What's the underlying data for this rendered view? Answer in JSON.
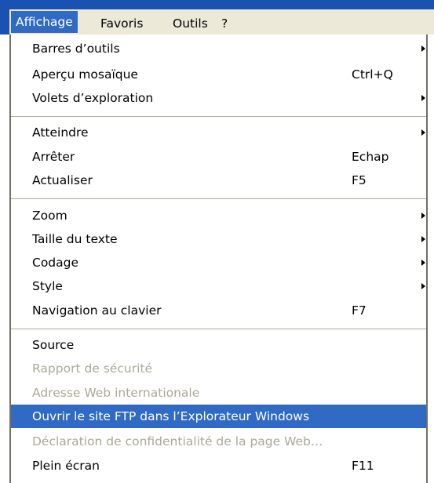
{
  "colors": {
    "frame": "#1a52b3",
    "menu_background": "#ece9d8",
    "highlight": "#316ac5",
    "disabled_text": "#aca899",
    "text": "#000000"
  },
  "menubar": {
    "items": [
      {
        "label": "Affichage",
        "active": true
      },
      {
        "label": "Favoris",
        "active": false
      },
      {
        "label": "Outils",
        "active": false
      },
      {
        "label": "?",
        "active": false
      }
    ]
  },
  "menu": {
    "items": [
      {
        "label": "Barres d’outils",
        "shortcut": "",
        "submenu": true,
        "enabled": true,
        "highlighted": false
      },
      {
        "label": "Aperçu mosaïque",
        "shortcut": "Ctrl+Q",
        "submenu": false,
        "enabled": true,
        "highlighted": false
      },
      {
        "label": "Volets d’exploration",
        "shortcut": "",
        "submenu": true,
        "enabled": true,
        "highlighted": false
      },
      {
        "label": "Atteindre",
        "shortcut": "",
        "submenu": true,
        "enabled": true,
        "highlighted": false
      },
      {
        "label": "Arrêter",
        "shortcut": "Echap",
        "submenu": false,
        "enabled": true,
        "highlighted": false
      },
      {
        "label": "Actualiser",
        "shortcut": "F5",
        "submenu": false,
        "enabled": true,
        "highlighted": false
      },
      {
        "label": "Zoom",
        "shortcut": "",
        "submenu": true,
        "enabled": true,
        "highlighted": false
      },
      {
        "label": "Taille du texte",
        "shortcut": "",
        "submenu": true,
        "enabled": true,
        "highlighted": false
      },
      {
        "label": "Codage",
        "shortcut": "",
        "submenu": true,
        "enabled": true,
        "highlighted": false
      },
      {
        "label": "Style",
        "shortcut": "",
        "submenu": true,
        "enabled": true,
        "highlighted": false
      },
      {
        "label": "Navigation au clavier",
        "shortcut": "F7",
        "submenu": false,
        "enabled": true,
        "highlighted": false
      },
      {
        "label": "Source",
        "shortcut": "",
        "submenu": false,
        "enabled": true,
        "highlighted": false
      },
      {
        "label": "Rapport de sécurité",
        "shortcut": "",
        "submenu": false,
        "enabled": false,
        "highlighted": false
      },
      {
        "label": "Adresse Web internationale",
        "shortcut": "",
        "submenu": false,
        "enabled": false,
        "highlighted": false
      },
      {
        "label": "Ouvrir le site FTP dans l’Explorateur Windows",
        "shortcut": "",
        "submenu": false,
        "enabled": true,
        "highlighted": true
      },
      {
        "label": "Déclaration de confidentialité de la page Web…",
        "shortcut": "",
        "submenu": false,
        "enabled": false,
        "highlighted": false
      },
      {
        "label": "Plein écran",
        "shortcut": "F11",
        "submenu": false,
        "enabled": true,
        "highlighted": false
      }
    ]
  }
}
